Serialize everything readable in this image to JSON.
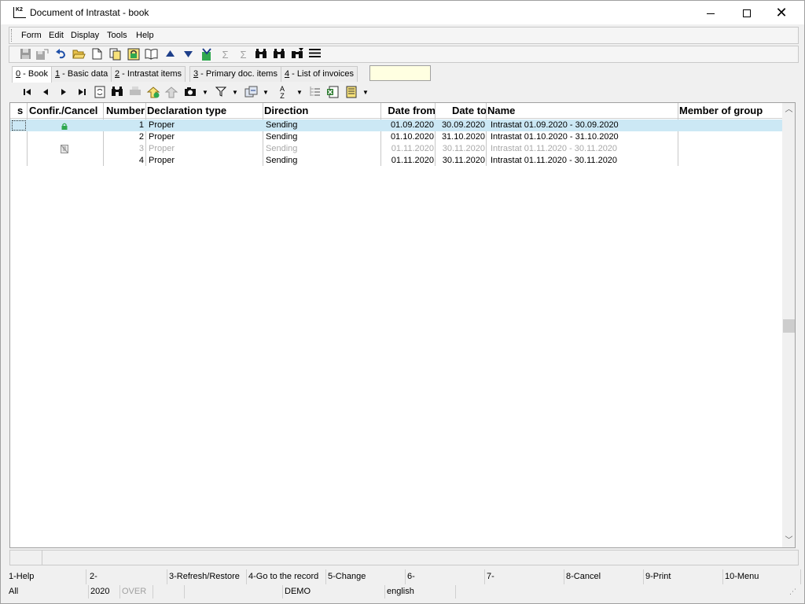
{
  "window": {
    "title": "Document of Intrastat - book",
    "icon_text": "K2"
  },
  "menu": [
    "Form",
    "Edit",
    "Display",
    "Tools",
    "Help"
  ],
  "toolbar_icons": [
    "save-icon",
    "save-as-icon",
    "undo-icon",
    "open-folder-icon",
    "new-document-icon",
    "copy-icon",
    "lock-icon",
    "book-icon",
    "arrow-up-icon",
    "arrow-down-icon",
    "import-icon",
    "sum-icon",
    "sum-filter-icon",
    "binoculars-icon",
    "binoculars-next-icon",
    "binoculars-filter-icon",
    "menu-lines-icon"
  ],
  "tabs": [
    {
      "key": "0",
      "label": " - Book"
    },
    {
      "key": "1",
      "label": " - Basic data"
    },
    {
      "key": "2",
      "label": " - Intrastat items"
    },
    {
      "key": "3",
      "label": " - Primary doc. items"
    },
    {
      "key": "4",
      "label": " - List of invoices"
    }
  ],
  "table_toolbar_icons": [
    "first-record-icon",
    "previous-record-icon",
    "next-record-icon",
    "last-record-icon",
    "refresh-icon",
    "find-icon",
    "print-icon",
    "add-icon",
    "remove-icon",
    "camera-icon",
    "filter-icon",
    "copy-columns-icon",
    "sort-icon",
    "tree-icon",
    "excel-icon",
    "report-icon"
  ],
  "table": {
    "columns": {
      "s": "s",
      "confir": "Confir./Cancel",
      "number": "Number",
      "decl_type": "Declaration type",
      "direction": "Direction",
      "date_from": "Date from",
      "date_to": "Date to",
      "name": "Name",
      "member": "Member of group"
    },
    "rows": [
      {
        "status_icon": "lock-icon",
        "number": "1",
        "decl_type": "Proper",
        "direction": "Sending",
        "date_from": "01.09.2020",
        "date_to": "30.09.2020",
        "name": "Intrastat 01.09.2020 - 30.09.2020",
        "member": ""
      },
      {
        "status_icon": "",
        "number": "2",
        "decl_type": "Proper",
        "direction": "Sending",
        "date_from": "01.10.2020",
        "date_to": "31.10.2020",
        "name": "Intrastat 01.10.2020 - 31.10.2020",
        "member": ""
      },
      {
        "status_icon": "cancelled-icon",
        "number": "3",
        "decl_type": "Proper",
        "direction": "Sending",
        "date_from": "01.11.2020",
        "date_to": "30.11.2020",
        "name": "Intrastat 01.11.2020 - 30.11.2020",
        "member": ""
      },
      {
        "status_icon": "",
        "number": "4",
        "decl_type": "Proper",
        "direction": "Sending",
        "date_from": "01.11.2020",
        "date_to": "30.11.2020",
        "name": "Intrastat 01.11.2020 - 30.11.2020",
        "member": ""
      }
    ]
  },
  "fkeys": [
    "1-Help",
    "2-",
    "3-Refresh/Restore",
    "4-Go to the record",
    "5-Change",
    "6-",
    "7-",
    "8-Cancel",
    "9-Print",
    "10-Menu"
  ],
  "status": {
    "filter": "All",
    "year": "2020",
    "mode": "OVER",
    "db": "DEMO",
    "language": "english"
  },
  "colors": {
    "selected_row": "#cce8f5",
    "cancelled_text": "#a8a8a8",
    "lock_green": "#2fa84f"
  }
}
